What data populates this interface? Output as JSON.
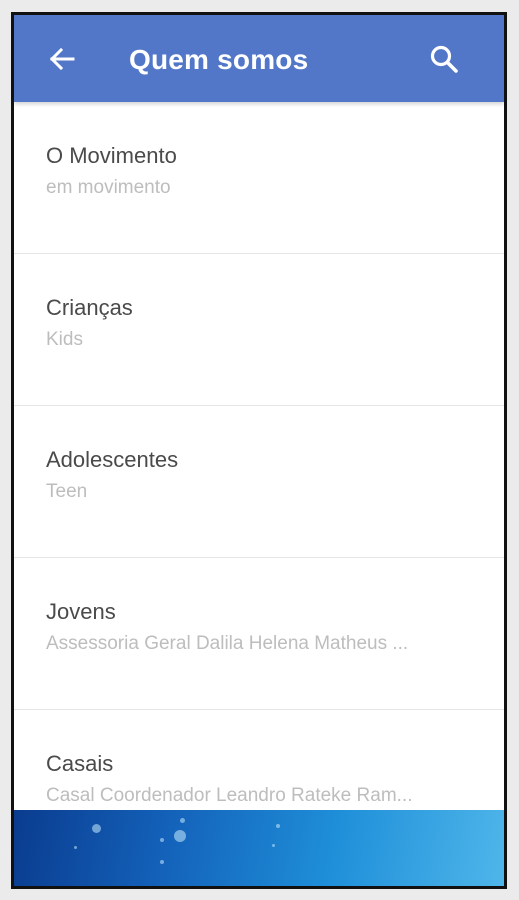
{
  "header": {
    "title": "Quem somos",
    "back_icon": "arrow-left-icon",
    "search_icon": "search-icon",
    "background_color": "#5277c8"
  },
  "list": {
    "items": [
      {
        "title": "O Movimento",
        "subtitle": "em movimento"
      },
      {
        "title": "Crianças",
        "subtitle": "Kids"
      },
      {
        "title": "Adolescentes",
        "subtitle": "Teen"
      },
      {
        "title": "Jovens",
        "subtitle": "Assessoria Geral Dalila Helena Matheus ..."
      },
      {
        "title": "Casais",
        "subtitle": "Casal Coordenador Leandro Rateke Ram..."
      }
    ]
  },
  "banner": {
    "image": "water-bubbles-banner"
  }
}
